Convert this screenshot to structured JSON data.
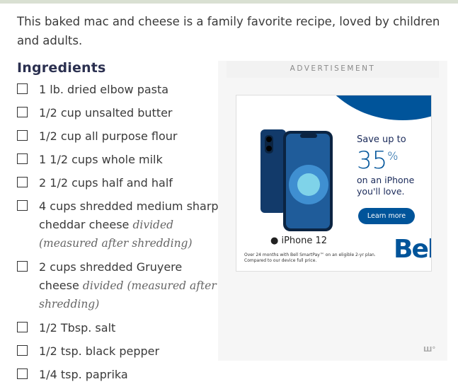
{
  "intro": "This baked mac and cheese is a family favorite recipe, loved by children and adults.",
  "ingredients_heading": "Ingredients",
  "ingredients": [
    {
      "text": "1 lb. dried elbow pasta",
      "note": ""
    },
    {
      "text": "1/2 cup unsalted butter",
      "note": ""
    },
    {
      "text": "1/2 cup all purpose flour",
      "note": ""
    },
    {
      "text": "1 1/2 cups whole milk",
      "note": ""
    },
    {
      "text": "2 1/2 cups half and half",
      "note": ""
    },
    {
      "text": "4 cups shredded medium sharp cheddar cheese",
      "note": "divided (measured after shredding)"
    },
    {
      "text": "2 cups shredded Gruyere cheese",
      "note": "divided (measured after shredding)"
    },
    {
      "text": "1/2 Tbsp. salt",
      "note": ""
    },
    {
      "text": "1/2 tsp. black pepper",
      "note": ""
    },
    {
      "text": "1/4 tsp. paprika",
      "note": ""
    }
  ],
  "ad": {
    "label": "ADVERTISEMENT",
    "phone_name": "iPhone 12",
    "save_text": "Save up to",
    "percent": "35",
    "percent_sign": "%",
    "phone_text": "on an iPhone you'll love.",
    "button_label": "Learn more",
    "fine_print": "Over 24 months with Bell SmartPay™ on an eligible 2-yr plan. Compared to our device full price.",
    "brand": "Bell",
    "badge": "Ш°"
  },
  "colors": {
    "heading": "#2b3050",
    "brand_blue": "#00549a",
    "top_bar": "#d9e0d2"
  }
}
